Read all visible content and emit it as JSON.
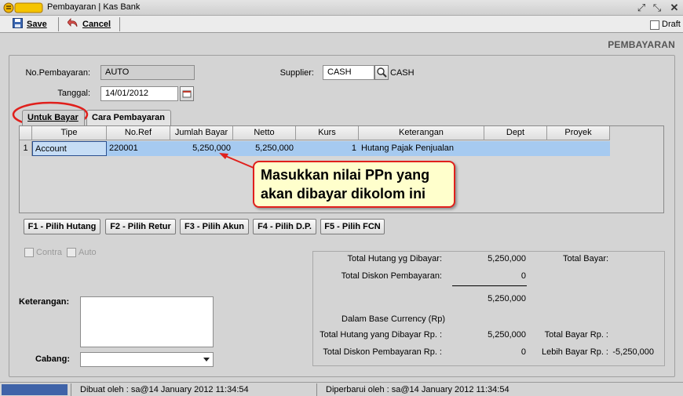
{
  "window": {
    "app_logo": "BEE",
    "title": "Pembayaran | Kas Bank"
  },
  "toolbar": {
    "save_label": "Save",
    "cancel_label": "Cancel",
    "draft_label": "Draft"
  },
  "heading": "PEMBAYARAN",
  "form": {
    "no_pembayaran_label": "No.Pembayaran:",
    "no_pembayaran_value": "AUTO",
    "tanggal_label": "Tanggal:",
    "tanggal_value": "14/01/2012",
    "supplier_label": "Supplier:",
    "supplier_value": "CASH",
    "supplier_name": "CASH"
  },
  "tabs": [
    {
      "label": "Untuk Bayar",
      "active": true
    },
    {
      "label": "Cara Pembayaran",
      "active": false
    }
  ],
  "grid": {
    "columns": [
      "Tipe",
      "No.Ref",
      "Jumlah Bayar",
      "Netto",
      "Kurs",
      "Keterangan",
      "Dept",
      "Proyek"
    ],
    "rows": [
      {
        "no": "1",
        "tipe": "Account",
        "no_ref": "220001",
        "jumlah_bayar": "5,250,000",
        "netto": "5,250,000",
        "kurs": "1",
        "keterangan": "Hutang Pajak Penjualan",
        "dept": "",
        "proyek": ""
      }
    ]
  },
  "grid_buttons": [
    "F1 - Pilih Hutang",
    "F2 - Pilih Retur",
    "F3 - Pilih Akun",
    "F4 - Pilih D.P.",
    "F5 - Pilih FCN"
  ],
  "options": {
    "contra_label": "Contra",
    "auto_label": "Auto"
  },
  "bottom": {
    "keterangan_label": "Keterangan:",
    "cabang_label": "Cabang:"
  },
  "summary": {
    "total_hutang_label": "Total Hutang yg Dibayar:",
    "total_hutang_value": "5,250,000",
    "total_bayar_label": "Total Bayar:",
    "total_diskon_label": "Total Diskon Pembayaran:",
    "total_diskon_value": "0",
    "subtotal_value": "5,250,000",
    "base_currency_label": "Dalam Base Currency (Rp)",
    "total_hutang_rp_label": "Total Hutang yang Dibayar Rp. :",
    "total_hutang_rp_value": "5,250,000",
    "total_bayar_rp_label": "Total Bayar Rp. :",
    "total_diskon_rp_label": "Total Diskon Pembayaran Rp. :",
    "total_diskon_rp_value": "0",
    "lebih_bayar_label": "Lebih Bayar Rp. :",
    "lebih_bayar_value": "-5,250,000"
  },
  "callout": {
    "line1": "Masukkan nilai PPn yang",
    "line2": "akan dibayar dikolom ini"
  },
  "status": {
    "dibuat": "Dibuat oleh : sa@14 January 2012  11:34:54",
    "diperbarui": "Diperbarui oleh : sa@14 January 2012  11:34:54"
  },
  "colors": {
    "selected_row": "#a6caf0",
    "callout_border": "#e0201c",
    "callout_bg": "#ffffcc"
  },
  "icons": [
    "bee-logo-icon",
    "restore-icon",
    "maximize-icon",
    "close-icon",
    "save-icon",
    "cancel-icon",
    "calendar-icon",
    "search-icon",
    "dropdown-arrow-icon"
  ]
}
